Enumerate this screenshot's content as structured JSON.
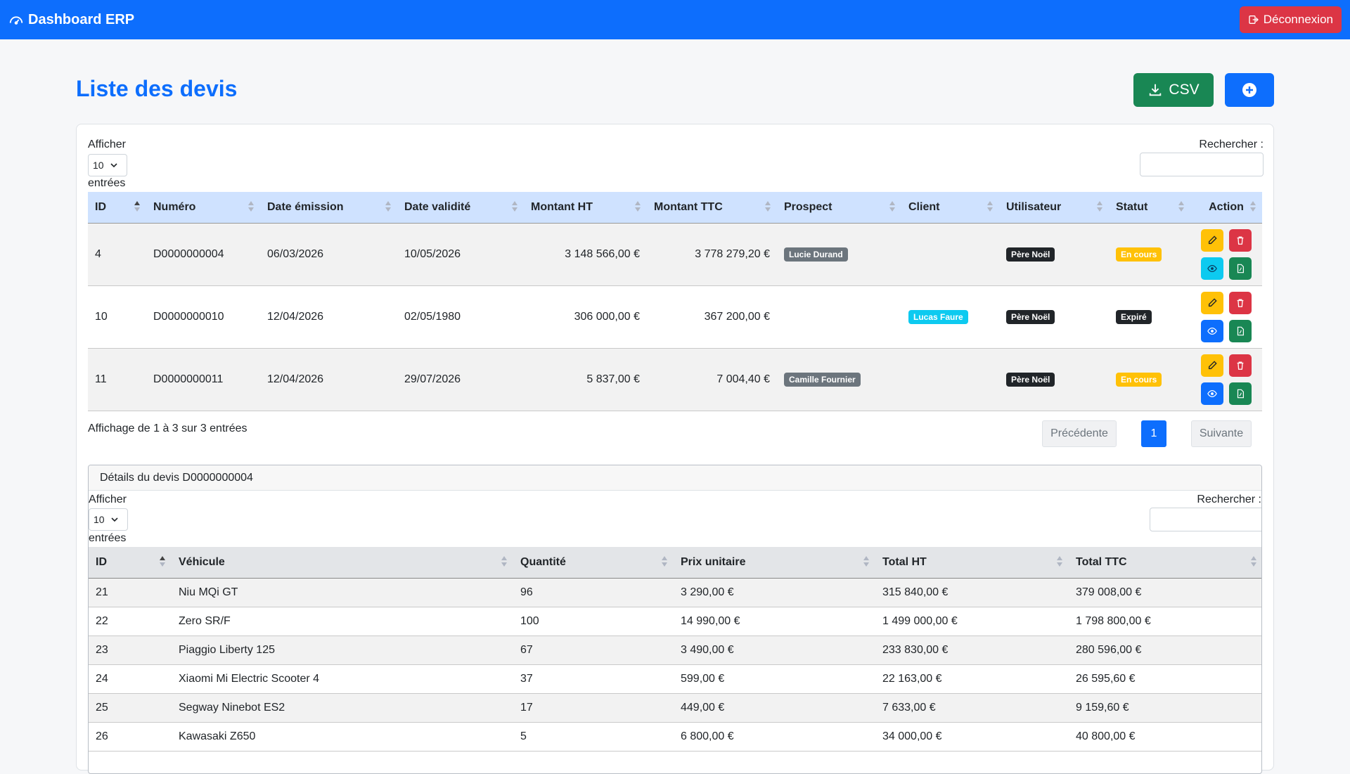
{
  "navbar": {
    "brand": "Dashboard ERP",
    "logout_label": "Déconnexion",
    "brand_icon": "speedometer-icon",
    "logout_icon": "logout-icon"
  },
  "page": {
    "title": "Liste des devis",
    "csv_label": "CSV"
  },
  "list_controls": {
    "show_label": "Afficher",
    "page_size": "10",
    "entries_label": "entrées",
    "search_label": "Rechercher :"
  },
  "quotes_table": {
    "headers": [
      "ID",
      "Numéro",
      "Date émission",
      "Date validité",
      "Montant HT",
      "Montant TTC",
      "Prospect",
      "Client",
      "Utilisateur",
      "Statut",
      "Action"
    ],
    "rows": [
      {
        "id": "4",
        "numero": "D0000000004",
        "date_emission": "06/03/2026",
        "date_validite": "10/05/2026",
        "montant_ht": "3 148 566,00 €",
        "montant_ttc": "3 778 279,20 €",
        "prospect": "Lucie Durand",
        "client": "",
        "utilisateur": "Père Noël",
        "statut": "En cours"
      },
      {
        "id": "10",
        "numero": "D0000000010",
        "date_emission": "12/04/2026",
        "date_validite": "02/05/1980",
        "montant_ht": "306 000,00 €",
        "montant_ttc": "367 200,00 €",
        "prospect": "",
        "client": "Lucas Faure",
        "utilisateur": "Père Noël",
        "statut": "Expiré"
      },
      {
        "id": "11",
        "numero": "D0000000011",
        "date_emission": "12/04/2026",
        "date_validite": "29/07/2026",
        "montant_ht": "5 837,00 €",
        "montant_ttc": "7 004,40 €",
        "prospect": "Camille Fournier",
        "client": "",
        "utilisateur": "Père Noël",
        "statut": "En cours"
      }
    ]
  },
  "pagination": {
    "info": "Affichage de 1 à 3 sur 3 entrées",
    "previous": "Précédente",
    "current_page": "1",
    "next": "Suivante"
  },
  "details": {
    "title": "Détails du devis D0000000004",
    "show_label": "Afficher",
    "page_size": "10",
    "entries_label": "entrées",
    "search_label": "Rechercher :",
    "headers": [
      "ID",
      "Véhicule",
      "Quantité",
      "Prix unitaire",
      "Total HT",
      "Total TTC"
    ],
    "rows": [
      [
        "21",
        "Niu MQi GT",
        "96",
        "3 290,00 €",
        "315 840,00 €",
        "379 008,00 €"
      ],
      [
        "22",
        "Zero SR/F",
        "100",
        "14 990,00 €",
        "1 499 000,00 €",
        "1 798 800,00 €"
      ],
      [
        "23",
        "Piaggio Liberty 125",
        "67",
        "3 490,00 €",
        "233 830,00 €",
        "280 596,00 €"
      ],
      [
        "24",
        "Xiaomi Mi Electric Scooter 4",
        "37",
        "599,00 €",
        "22 163,00 €",
        "26 595,60 €"
      ],
      [
        "25",
        "Segway Ninebot ES2",
        "17",
        "449,00 €",
        "7 633,00 €",
        "9 159,60 €"
      ],
      [
        "26",
        "Kawasaki Z650",
        "5",
        "6 800,00 €",
        "34 000,00 €",
        "40 800,00 €"
      ]
    ]
  },
  "colors": {
    "primary": "#0d6efd",
    "success": "#198754",
    "danger": "#dc3545",
    "warning": "#ffc107",
    "info": "#0dcaf0",
    "dark": "#212529",
    "secondary": "#6c757d"
  }
}
